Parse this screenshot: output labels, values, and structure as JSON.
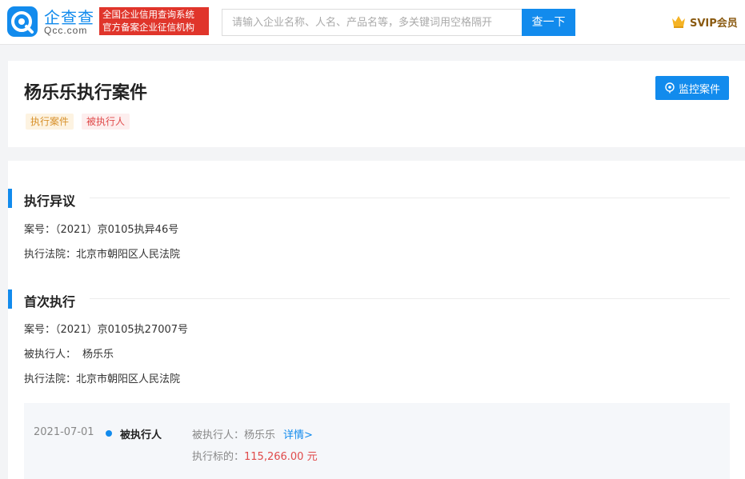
{
  "header": {
    "logo_cn": "企查查",
    "logo_en": "Qcc.com",
    "gov_badge_line1": "全国企业信用查询系统",
    "gov_badge_line2": "官方备案企业征信机构",
    "search_placeholder": "请输入企业名称、人名、产品名等，多关键词用空格隔开",
    "search_button": "查一下",
    "svip_label": "SVIP会员"
  },
  "title_card": {
    "title": "杨乐乐执行案件",
    "tags": [
      "执行案件",
      "被执行人"
    ],
    "monitor_button": "监控案件"
  },
  "sections": [
    {
      "title": "执行异议",
      "rows": [
        {
          "label": "案号：",
          "value": "（2021）京0105执异46号"
        },
        {
          "label": "执行法院：",
          "value": "北京市朝阳区人民法院"
        }
      ]
    },
    {
      "title": "首次执行",
      "rows": [
        {
          "label": "案号：",
          "value": "（2021）京0105执27007号"
        },
        {
          "label": "被执行人：",
          "value": "杨乐乐"
        },
        {
          "label": "执行法院：",
          "value": "北京市朝阳区人民法院"
        }
      ]
    }
  ],
  "timeline": {
    "date": "2021-07-01",
    "role": "被执行人",
    "person_label": "被执行人：",
    "person_value": "杨乐乐",
    "detail_link": "详情>",
    "amount_label": "执行标的：",
    "amount_value": "115,266.00 元"
  },
  "colors": {
    "brand_blue": "#128bed",
    "badge_red": "#e0352b",
    "amount_red": "#e04a4a",
    "tag_orange": "#d8902a"
  },
  "icons": [
    "qcc-logo-icon",
    "crown-icon",
    "monitor-icon"
  ]
}
